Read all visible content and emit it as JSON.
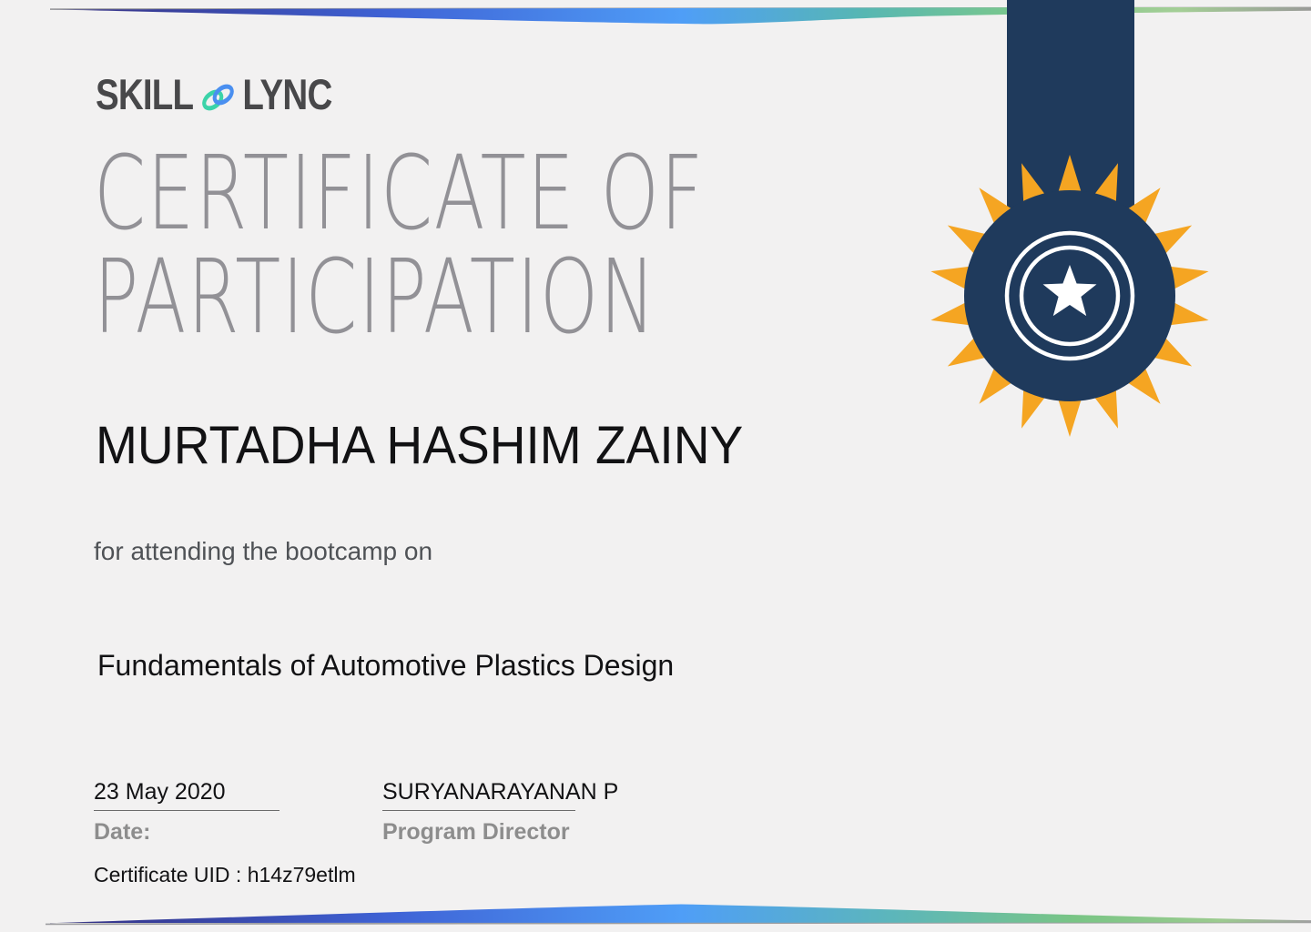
{
  "brand": {
    "logo_left": "SKILL",
    "logo_right": "LYNC"
  },
  "title": {
    "line1": "CERTIFICATE OF",
    "line2": "PARTICIPATION"
  },
  "recipient": {
    "name": "MURTADHA HASHIM ZAINY"
  },
  "subtitle": "for attending the bootcamp on",
  "course": "Fundamentals of Automotive Plastics Design",
  "footer": {
    "date_value": "23 May 2020",
    "date_label": "Date:",
    "signer_name": "SURYANARAYANAN P",
    "signer_title": "Program Director",
    "uid": "Certificate UID : h14z79etlm"
  },
  "colors": {
    "bg": "#f2f1f1",
    "navy": "#1f3a5c",
    "orange": "#f5a522",
    "logo-gray": "#48484a",
    "title-gray": "#929196",
    "text-dark": "#121214",
    "subtitle-gray": "#4f5256",
    "muted-gray": "#8d8d8d",
    "chain-teal": "#3bd3a8",
    "chain-blue": "#4a8ff0",
    "swoosh-indigo": "#37368c",
    "swoosh-blue": "#4f9ef7",
    "swoosh-teal": "#57b7b2",
    "swoosh-green": "#7cc88b"
  }
}
